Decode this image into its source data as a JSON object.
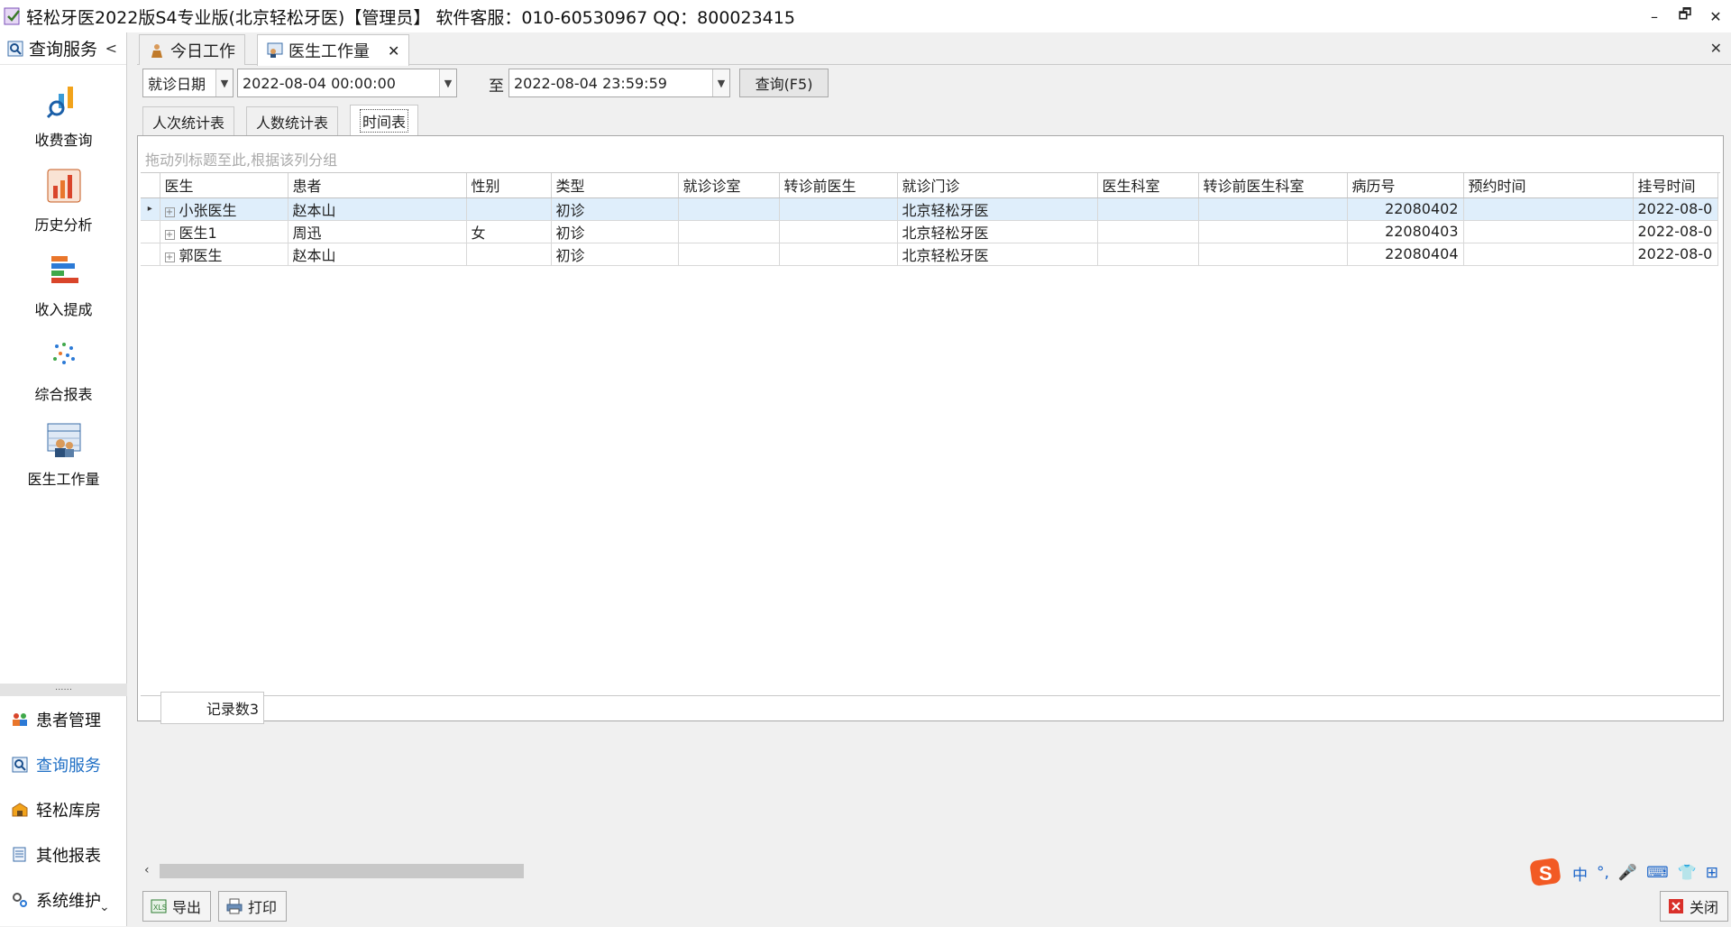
{
  "window": {
    "title": "轻松牙医2022版S4专业版(北京轻松牙医)【管理员】   软件客服：010-60530967 QQ：800023415",
    "controls": [
      "–",
      "🗗",
      "✕"
    ]
  },
  "sidebar": {
    "header": "查询服务",
    "collapse_glyph": "<",
    "tiles": [
      {
        "label": "收费查询",
        "icon": "fee-query-icon"
      },
      {
        "label": "历史分析",
        "icon": "history-analysis-icon"
      },
      {
        "label": "收入提成",
        "icon": "income-commission-icon"
      },
      {
        "label": "综合报表",
        "icon": "comprehensive-report-icon"
      },
      {
        "label": "医生工作量",
        "icon": "doctor-workload-icon"
      }
    ],
    "divider": "......",
    "nav": [
      {
        "label": "患者管理",
        "icon": "patients-icon"
      },
      {
        "label": "查询服务",
        "icon": "query-service-icon",
        "active": true
      },
      {
        "label": "轻松库房",
        "icon": "warehouse-icon"
      },
      {
        "label": "其他报表",
        "icon": "other-reports-icon"
      },
      {
        "label": "系统维护",
        "icon": "system-maintenance-icon"
      }
    ],
    "bottom_chevron": "⌄"
  },
  "tabs": {
    "items": [
      {
        "label": "今日工作"
      },
      {
        "label": "医生工作量",
        "active": true,
        "close": "✕"
      }
    ],
    "strip_close": "✕"
  },
  "filter": {
    "date_type": "就诊日期",
    "start": "2022-08-04 00:00:00",
    "to_label": "至",
    "end": "2022-08-04 23:59:59",
    "query_button": "查询(F5)"
  },
  "subtabs": [
    {
      "label": "人次统计表"
    },
    {
      "label": "人数统计表"
    },
    {
      "label": "时间表",
      "active": true
    }
  ],
  "grid": {
    "group_hint": "拖动列标题至此,根据该列分组",
    "columns": [
      "医生",
      "患者",
      "性别",
      "类型",
      "就诊诊室",
      "转诊前医生",
      "就诊门诊",
      "医生科室",
      "转诊前医生科室",
      "病历号",
      "预约时间",
      "挂号时间"
    ],
    "rows": [
      {
        "doctor": "小张医生",
        "patient": "赵本山",
        "sex": "",
        "type": "初诊",
        "room": "",
        "prev_doctor": "",
        "clinic": "北京轻松牙医",
        "dept": "",
        "prev_dept": "",
        "record_no": "22080402",
        "appt_time": "",
        "reg_time": "2022-08-0"
      },
      {
        "doctor": "医生1",
        "patient": "周迅",
        "sex": "女",
        "type": "初诊",
        "room": "",
        "prev_doctor": "",
        "clinic": "北京轻松牙医",
        "dept": "",
        "prev_dept": "",
        "record_no": "22080403",
        "appt_time": "",
        "reg_time": "2022-08-0"
      },
      {
        "doctor": "郭医生",
        "patient": "赵本山",
        "sex": "",
        "type": "初诊",
        "room": "",
        "prev_doctor": "",
        "clinic": "北京轻松牙医",
        "dept": "",
        "prev_dept": "",
        "record_no": "22080404",
        "appt_time": "",
        "reg_time": "2022-08-0"
      }
    ],
    "record_count": "记录数3"
  },
  "actions": {
    "export": "导出",
    "print": "打印",
    "close": "关闭"
  },
  "ime": {
    "items": [
      "中",
      "°,",
      "🎤",
      "⌨",
      "👕",
      "⊞"
    ]
  },
  "colors": {
    "accent": "#1f6fc5",
    "selected_row": "#dfeefb"
  }
}
